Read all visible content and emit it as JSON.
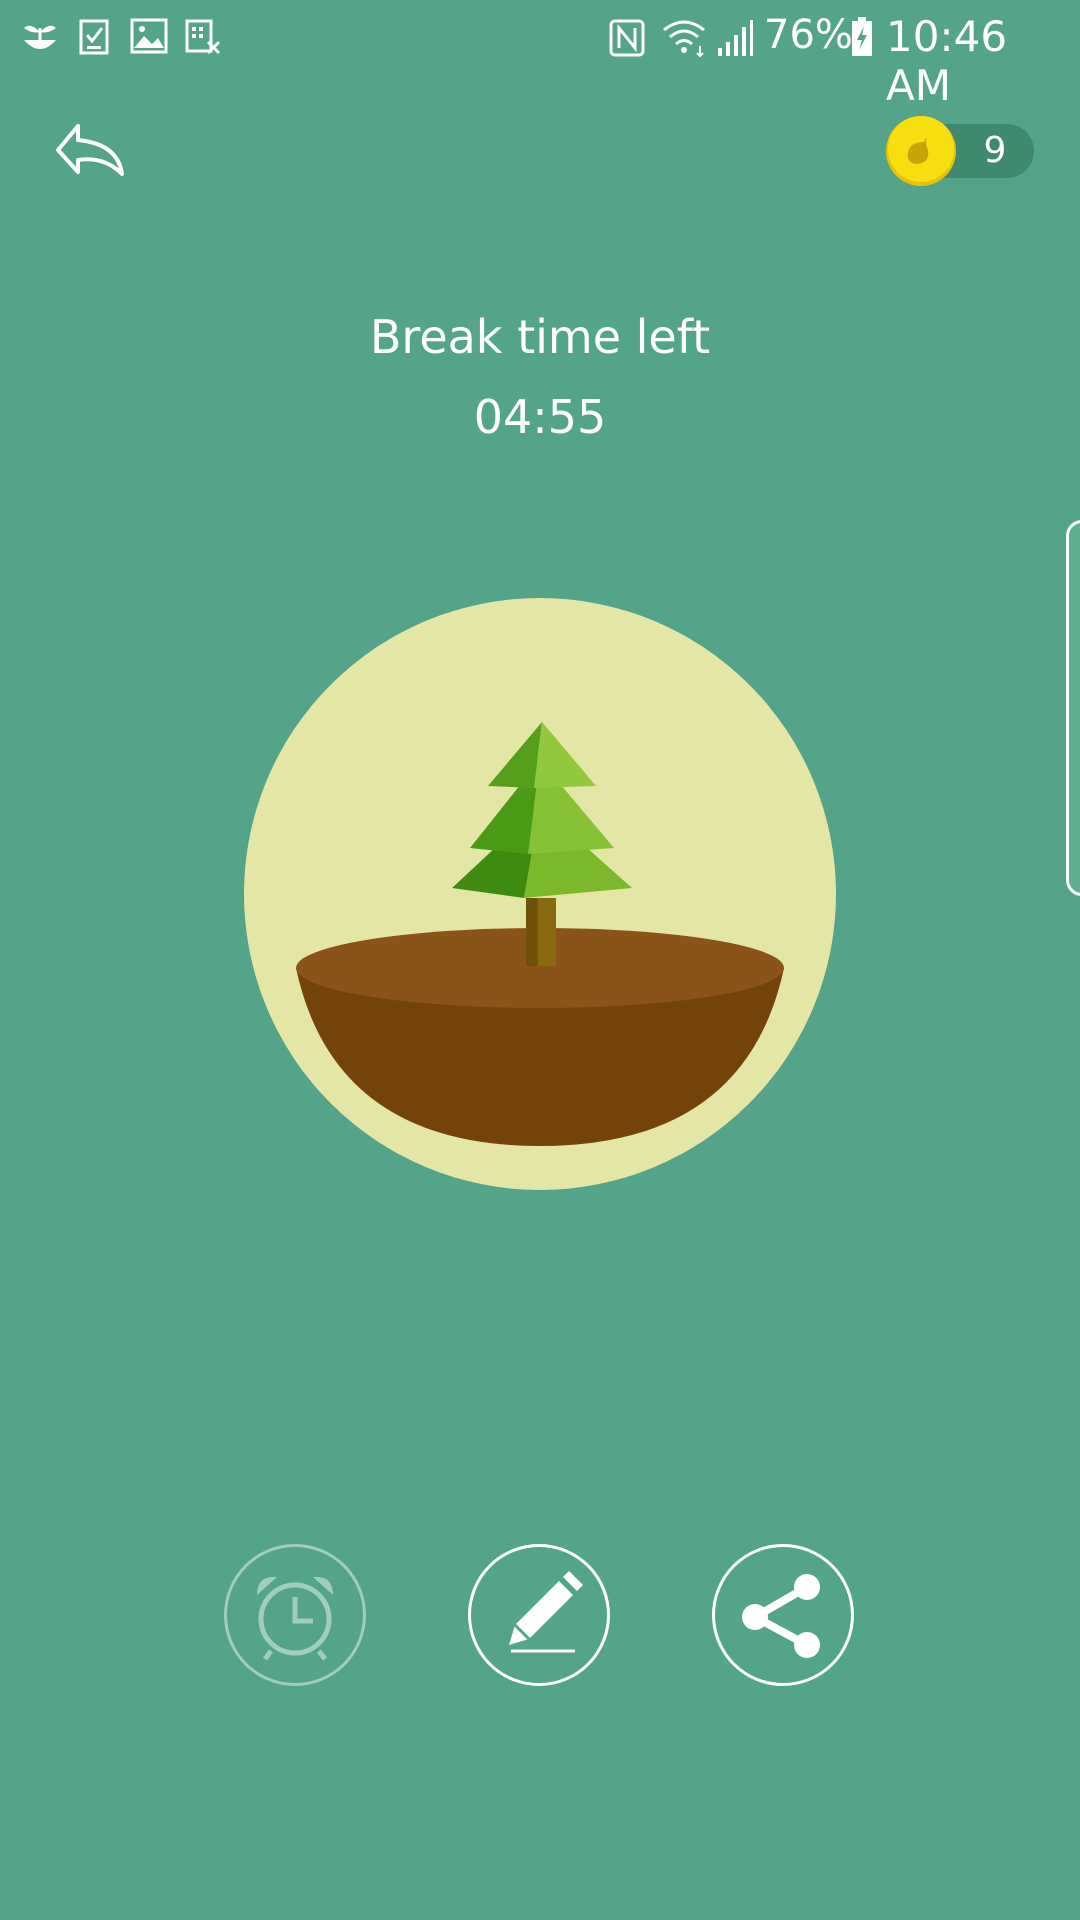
{
  "status_bar": {
    "battery_percent": "76%",
    "time": "10:46 AM",
    "left_icons": [
      "forest-app-icon",
      "task-check-icon",
      "gallery-icon",
      "notes-icon"
    ],
    "right_icons": [
      "nfc-icon",
      "wifi-icon",
      "signal-icon",
      "battery-charging-icon"
    ]
  },
  "header": {
    "coins": "9"
  },
  "main": {
    "label": "Break time left",
    "timer": "04:55"
  },
  "actions": [
    {
      "name": "alarm-button",
      "icon": "alarm-clock-icon",
      "enabled": false
    },
    {
      "name": "edit-button",
      "icon": "pencil-icon",
      "enabled": true
    },
    {
      "name": "share-button",
      "icon": "share-icon",
      "enabled": true
    }
  ],
  "colors": {
    "background": "#53a488",
    "circle": "#e3e6a4",
    "soil_top": "#8a5419",
    "soil_bottom": "#73430a",
    "coin": "#f5d90a",
    "foliage_light": "#8bc34a",
    "foliage_dark": "#3f8a10"
  }
}
